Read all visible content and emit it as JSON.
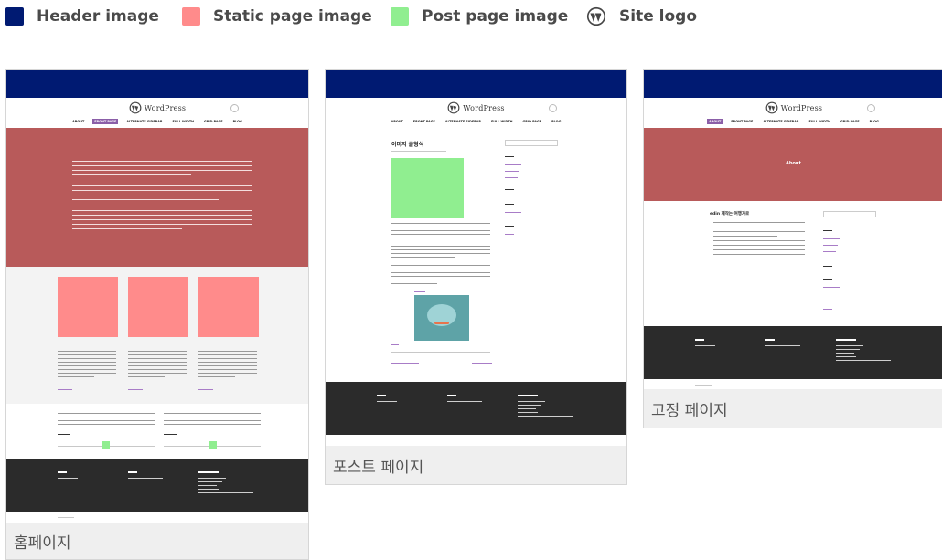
{
  "legend": {
    "items": [
      {
        "label": "Header image",
        "color": "#001a72"
      },
      {
        "label": "Static page image",
        "color": "#ff8b8b"
      },
      {
        "label": "Post page image",
        "color": "#90ee90"
      },
      {
        "label": "Site logo",
        "icon": "wordpress-logo-icon"
      }
    ]
  },
  "panels": {
    "home": {
      "caption": "홈페이지"
    },
    "post": {
      "caption": "포스트 페이지",
      "post_title": "이미지 글형식"
    },
    "static": {
      "caption": "고정 페이지",
      "about_label": "About",
      "page_heading": "edin 제작는 여행가로"
    }
  },
  "colors": {
    "header": "#001a72",
    "static_page": "#ff8b8b",
    "static_page_dark": "#b85a5a",
    "post_page": "#90ee90",
    "footer": "#2b2b2b",
    "nav_active": "#8b5fa8"
  },
  "mini_site": {
    "logo_text": "WordPress",
    "nav": [
      "ABOUT",
      "FRONT PAGE",
      "ALTERNATE SIDEBAR",
      "FULL WIDTH",
      "GRID PAGE",
      "BLOG"
    ]
  }
}
